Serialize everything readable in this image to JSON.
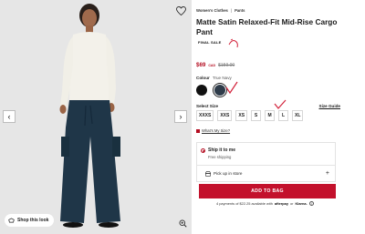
{
  "gallery": {
    "favorite_icon": "heart-outline-icon",
    "prev_icon": "chevron-left-icon",
    "next_icon": "chevron-right-icon",
    "shop_look_label": "Shop this look",
    "zoom_icon": "zoom-in-icon"
  },
  "breadcrumb": {
    "items": [
      "Women's Clothes",
      "Pants"
    ],
    "separator": "|"
  },
  "product": {
    "title": "Matte Satin Relaxed-Fit Mid-Rise Cargo Pant",
    "badge": "FINAL SALE",
    "price_now": "$69",
    "price_currency": "CAD",
    "price_was": "$159.00",
    "colour_label": "Colour",
    "colour_value": "True Navy",
    "colours": [
      {
        "name": "Black",
        "hex": "#111111",
        "selected": false
      },
      {
        "name": "True Navy",
        "hex": "#2f3c4a",
        "selected": true
      }
    ],
    "size_label": "Select Size",
    "size_guide_label": "Size Guide",
    "sizes": [
      "XXXS",
      "XXS",
      "XS",
      "S",
      "M",
      "L",
      "XL"
    ],
    "missing_size_label": "What's My Size?"
  },
  "shipping": {
    "ship_label": "Ship it to me",
    "ship_sub": "Free shipping",
    "pickup_label": "Pick up in store",
    "pickup_icon": "store-icon",
    "expand_icon": "plus-icon"
  },
  "cta": {
    "add_to_bag": "ADD TO BAG"
  },
  "payments": {
    "prefix": "4 payments of $22.25 available with",
    "provider_1": "afterpay",
    "connector": "or",
    "provider_2": "Klarna."
  },
  "colors": {
    "accent": "#c3112c",
    "sale_price": "#b40c20",
    "image_bg": "#e6e6e6"
  }
}
